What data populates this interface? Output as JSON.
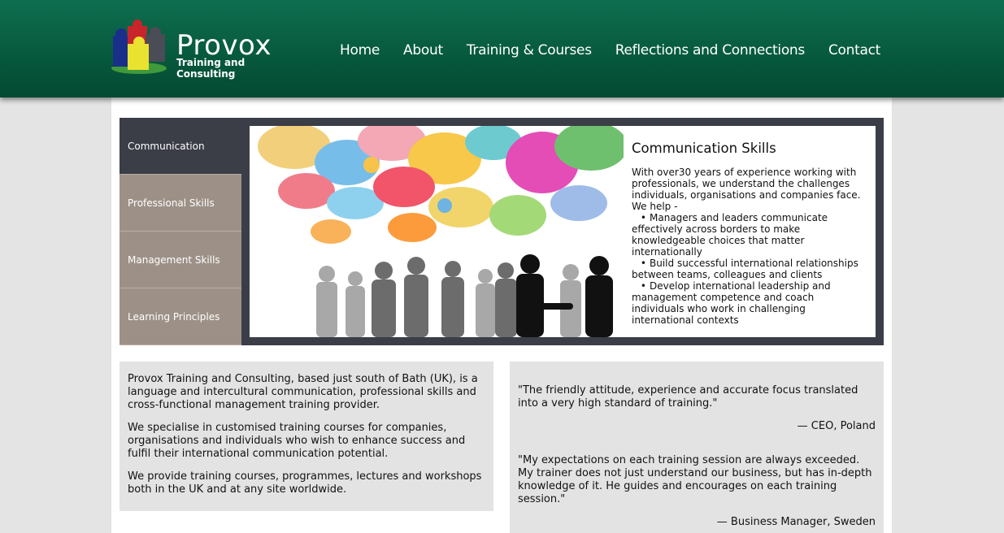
{
  "brand": {
    "title": "Provox",
    "subtitle": "Training and Consulting"
  },
  "nav": {
    "items": [
      "Home",
      "About",
      "Training & Courses",
      "Reflections and Connections",
      "Contact"
    ]
  },
  "slider": {
    "tabs": [
      "Communication",
      "Professional Skills",
      "Management Skills",
      "Learning Principles"
    ],
    "active_tab": "Communication",
    "title": "Communication Skills",
    "intro": "With over30 years of experience working with professionals, we understand the challenges individuals, organisations and companies face. We help -",
    "bullets": [
      "Managers and leaders communicate effectively across borders to make knowledgeable choices that matter internationally",
      "Build successful international relationships between teams, colleagues and clients",
      "Develop international leadership and management competence and coach individuals who work in challenging international contexts"
    ]
  },
  "about": {
    "paragraphs": [
      "Provox Training and Consulting, based just south of Bath (UK), is a language and intercultural communication, professional skills and cross-functional management training provider.",
      "We specialise in customised training courses for companies, organisations and individuals who wish to enhance success and fulfil their international communication potential.",
      "We provide training courses, programmes, lectures and workshops both in the UK and at any site worldwide."
    ]
  },
  "testimonials": [
    {
      "quote": "\"The friendly attitude, experience and accurate focus translated into a very high standard of training.\"",
      "author": "— CEO, Poland"
    },
    {
      "quote": "\"My expectations on each training session are always exceeded. My trainer does not just understand our business, but has in-depth knowledge of it. He guides and encourages on each training session.\"",
      "author": "— Business Manager, Sweden"
    }
  ],
  "colors": {
    "header_green": "#075a3e",
    "slider_dark": "#3b3d47",
    "tab_taupe": "#9d9187",
    "box_grey": "#e3e3e3"
  }
}
